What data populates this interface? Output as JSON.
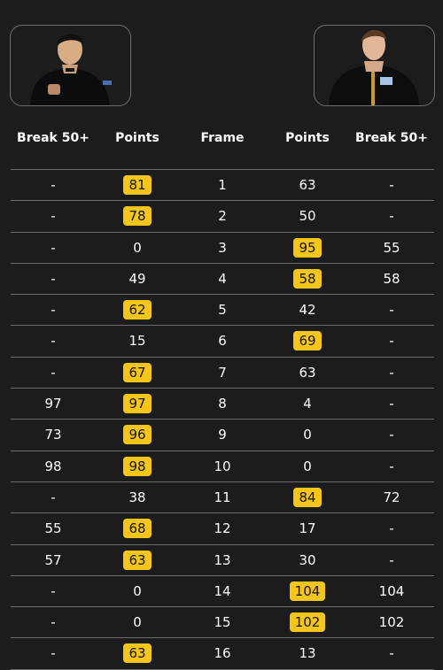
{
  "headers": {
    "break_left": "Break 50+",
    "points_left": "Points",
    "frame": "Frame",
    "points_right": "Points",
    "break_right": "Break 50+"
  },
  "colors": {
    "winner_highlight": "#f5c518",
    "background": "#1c1c1c"
  },
  "players": {
    "left": {
      "icon": "player-photo"
    },
    "right": {
      "icon": "player-photo"
    }
  },
  "frames": [
    {
      "break_left": "-",
      "points_left": "81",
      "frame": "1",
      "points_right": "63",
      "break_right": "-",
      "winner": "left"
    },
    {
      "break_left": "-",
      "points_left": "78",
      "frame": "2",
      "points_right": "50",
      "break_right": "-",
      "winner": "left"
    },
    {
      "break_left": "-",
      "points_left": "0",
      "frame": "3",
      "points_right": "95",
      "break_right": "55",
      "winner": "right"
    },
    {
      "break_left": "-",
      "points_left": "49",
      "frame": "4",
      "points_right": "58",
      "break_right": "58",
      "winner": "right"
    },
    {
      "break_left": "-",
      "points_left": "62",
      "frame": "5",
      "points_right": "42",
      "break_right": "-",
      "winner": "left"
    },
    {
      "break_left": "-",
      "points_left": "15",
      "frame": "6",
      "points_right": "69",
      "break_right": "-",
      "winner": "right"
    },
    {
      "break_left": "-",
      "points_left": "67",
      "frame": "7",
      "points_right": "63",
      "break_right": "-",
      "winner": "left"
    },
    {
      "break_left": "97",
      "points_left": "97",
      "frame": "8",
      "points_right": "4",
      "break_right": "-",
      "winner": "left"
    },
    {
      "break_left": "73",
      "points_left": "96",
      "frame": "9",
      "points_right": "0",
      "break_right": "-",
      "winner": "left"
    },
    {
      "break_left": "98",
      "points_left": "98",
      "frame": "10",
      "points_right": "0",
      "break_right": "-",
      "winner": "left"
    },
    {
      "break_left": "-",
      "points_left": "38",
      "frame": "11",
      "points_right": "84",
      "break_right": "72",
      "winner": "right"
    },
    {
      "break_left": "55",
      "points_left": "68",
      "frame": "12",
      "points_right": "17",
      "break_right": "-",
      "winner": "left"
    },
    {
      "break_left": "57",
      "points_left": "63",
      "frame": "13",
      "points_right": "30",
      "break_right": "-",
      "winner": "left"
    },
    {
      "break_left": "-",
      "points_left": "0",
      "frame": "14",
      "points_right": "104",
      "break_right": "104",
      "winner": "right"
    },
    {
      "break_left": "-",
      "points_left": "0",
      "frame": "15",
      "points_right": "102",
      "break_right": "102",
      "winner": "right"
    },
    {
      "break_left": "-",
      "points_left": "63",
      "frame": "16",
      "points_right": "13",
      "break_right": "-",
      "winner": "left"
    }
  ]
}
